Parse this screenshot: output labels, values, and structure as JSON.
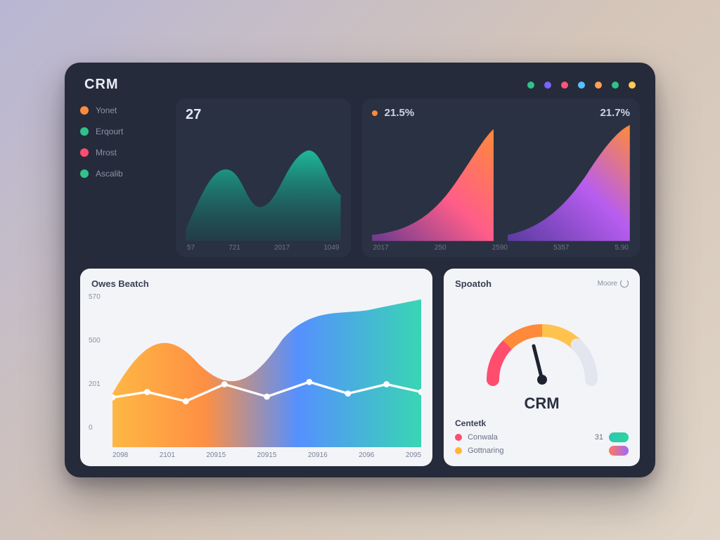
{
  "brand": "CRM",
  "status_dots": [
    "#2fc28b",
    "#7a63ff",
    "#ff5577",
    "#55c2ff",
    "#ff9e55",
    "#2fc28b",
    "#ffcc55"
  ],
  "sidebar": {
    "items": [
      {
        "color": "#ff8a3a",
        "label": "Yonet"
      },
      {
        "color": "#2fc28b",
        "label": "Erqourt"
      },
      {
        "color": "#ff4d6d",
        "label": "Mrost"
      },
      {
        "color": "#2fc28b",
        "label": "Ascalib"
      }
    ]
  },
  "card_a": {
    "metric": "27",
    "x": [
      "57",
      "721",
      "2017",
      "1049"
    ]
  },
  "card_b": {
    "metric_left": "21.5%",
    "metric_right": "21.7%",
    "dot_left": "#ff8a3a",
    "dot_right": "#ff8a3a",
    "x": [
      "2017",
      "250",
      "2590",
      "5357",
      "5.90"
    ]
  },
  "big_chart": {
    "title": "Owes Beatch",
    "y": [
      "570",
      "500",
      "201",
      "0"
    ],
    "x": [
      "2098",
      "2101",
      "20915",
      "20915",
      "20916",
      "2096",
      "2095"
    ]
  },
  "gauge_card": {
    "title": "Spoatoh",
    "more_label": "Moore",
    "center_label": "CRM",
    "sub_header": "Centetk",
    "legend": [
      {
        "dot": "#ff4d6d",
        "label": "Conwala",
        "value": "31",
        "pill": "linear-gradient(90deg,#2fc6b0,#2ad6a0)"
      },
      {
        "dot": "#ffb43a",
        "label": "Gottnaring",
        "value": "",
        "pill": "linear-gradient(90deg,#ff7a59,#a069ff)"
      }
    ]
  },
  "colors": {
    "teal": "#1fb89a",
    "teal2": "#2fd4b0",
    "pink": "#ff5d8a",
    "orange": "#ff8a3a",
    "purple": "#8a63ff",
    "yellow": "#ffc24d",
    "blue": "#4d8bff"
  },
  "chart_data": [
    {
      "type": "area",
      "title": "Card A wave",
      "x": [
        0,
        1,
        2,
        3,
        4,
        5,
        6
      ],
      "values": [
        10,
        35,
        60,
        30,
        55,
        78,
        40
      ],
      "ylim": [
        0,
        100
      ],
      "color": "teal"
    },
    {
      "type": "area",
      "title": "Card B growth (two series)",
      "x": [
        0,
        1,
        2,
        3,
        4
      ],
      "series": [
        {
          "name": "left",
          "values": [
            5,
            10,
            20,
            40,
            75
          ],
          "gradient": [
            "#ff5d8a",
            "#ff8a3a"
          ]
        },
        {
          "name": "right",
          "values": [
            5,
            12,
            28,
            55,
            90
          ],
          "gradient": [
            "#8a63ff",
            "#ff8a3a"
          ]
        }
      ],
      "ylim": [
        0,
        100
      ]
    },
    {
      "type": "area",
      "title": "Owes Beatch",
      "xlabel": "",
      "ylabel": "",
      "x": [
        "2098",
        "2101",
        "20915",
        "20915",
        "20916",
        "2096",
        "2095"
      ],
      "series": [
        {
          "name": "area",
          "values": [
            210,
            470,
            350,
            320,
            460,
            500,
            560
          ],
          "gradient": [
            "#ffc24d",
            "#4d8bff",
            "#2fd4b0"
          ]
        },
        {
          "name": "line",
          "values": [
            200,
            210,
            195,
            230,
            205,
            240,
            215
          ],
          "color": "#ffffff"
        }
      ],
      "ylim": [
        0,
        570
      ]
    },
    {
      "type": "pie",
      "title": "Spoatoh gauge",
      "categories": [
        "red",
        "orange",
        "yellow",
        "remaining"
      ],
      "values": [
        25,
        25,
        20,
        30
      ],
      "needle_percent": 55
    }
  ]
}
